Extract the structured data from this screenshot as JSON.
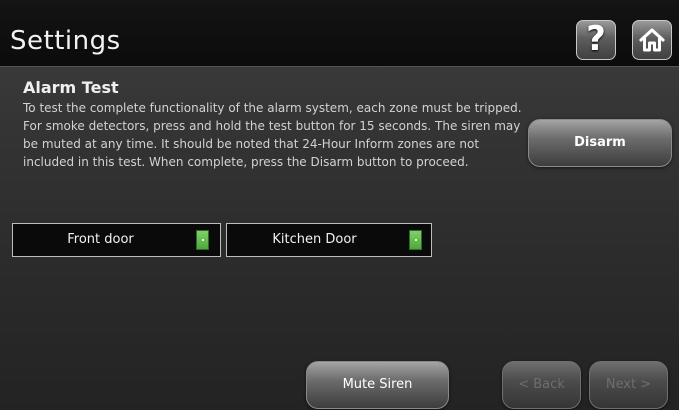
{
  "header": {
    "title": "Settings",
    "help_label": "?",
    "help_icon": "question-mark-icon",
    "home_icon": "home-icon"
  },
  "section": {
    "heading": "Alarm Test",
    "instructions": "To test the complete functionality of the alarm system, each zone must be tripped.  For smoke detectors, press and hold the test button for 15 seconds.  The siren may be muted at any time.  It should be noted that 24-Hour Inform zones are not included in this test.  When complete, press the Disarm button to proceed."
  },
  "actions": {
    "disarm_label": "Disarm",
    "mute_siren_label": "Mute Siren",
    "back_label": "< Back",
    "next_label": "Next >",
    "back_enabled": false,
    "next_enabled": false
  },
  "zones": [
    {
      "label": "Front door",
      "status_color": "#5fbf4a"
    },
    {
      "label": "Kitchen Door",
      "status_color": "#5fbf4a"
    }
  ]
}
